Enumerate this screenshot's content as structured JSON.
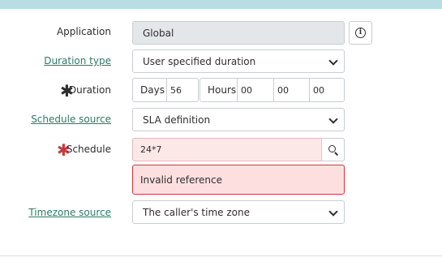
{
  "form": {
    "application": {
      "label": "Application",
      "value": "Global"
    },
    "duration_type": {
      "label": "Duration type",
      "value": "User specified duration"
    },
    "duration": {
      "label": "Duration",
      "required_mark": "✱",
      "days_label": "Days",
      "days_value": "56",
      "hours_label": "Hours",
      "hours_value": "00",
      "minutes_value": "00",
      "seconds_value": "00"
    },
    "schedule_source": {
      "label": "Schedule source",
      "value": "SLA definition"
    },
    "schedule": {
      "label": "Schedule",
      "required_mark": "✱",
      "value": "24*7",
      "error": "Invalid reference"
    },
    "timezone_source": {
      "label": "Timezone source",
      "value": "The caller's time zone"
    }
  },
  "colors": {
    "header_band": "#b8dde3",
    "link": "#2d7a62",
    "required_red": "#c8393f",
    "error_bg": "#fddfe0",
    "readonly_bg": "#e4e7ea"
  },
  "icons": {
    "info": "info-icon",
    "search": "search-icon",
    "dropdown": "chevron-down-icon",
    "required": "asterisk-icon"
  }
}
